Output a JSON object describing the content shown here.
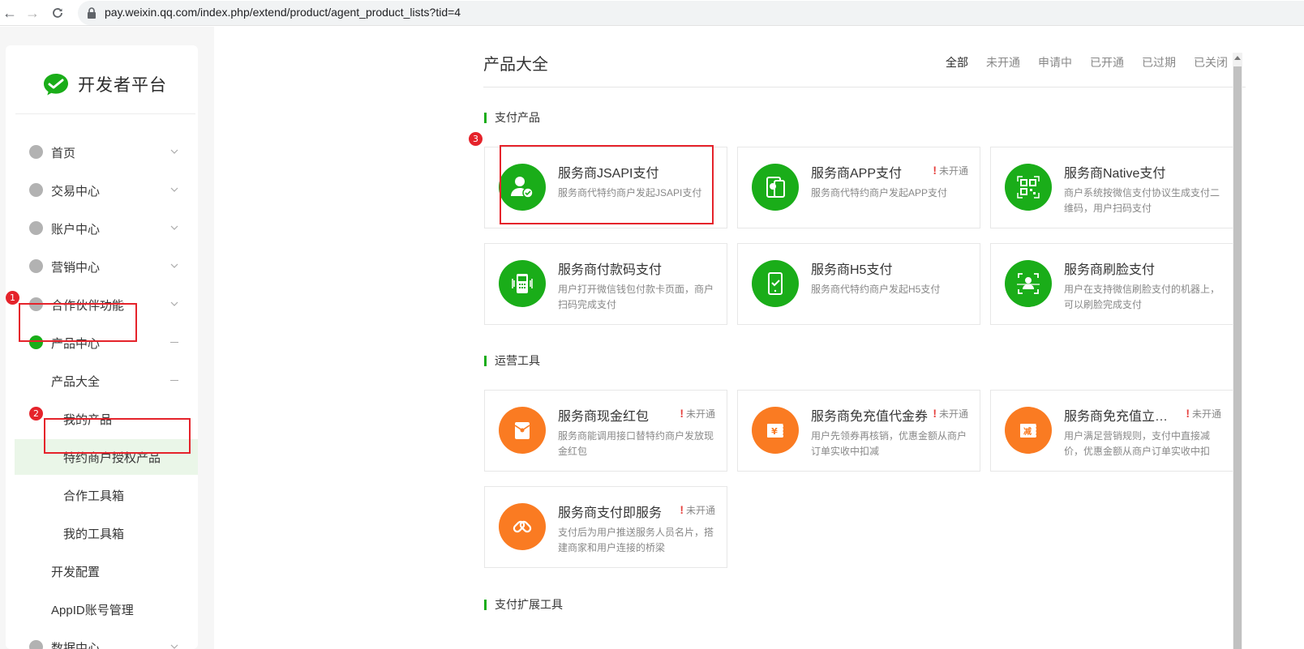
{
  "browser": {
    "url": "pay.weixin.qq.com/index.php/extend/product/agent_product_lists?tid=4"
  },
  "sidebar": {
    "logo_text": "开发者平台",
    "items": [
      {
        "label": "首页"
      },
      {
        "label": "交易中心"
      },
      {
        "label": "账户中心"
      },
      {
        "label": "营销中心"
      },
      {
        "label": "合作伙伴功能"
      },
      {
        "label": "产品中心"
      },
      {
        "label": "产品大全"
      },
      {
        "label": "我的产品"
      },
      {
        "label": "特约商户授权产品"
      },
      {
        "label": "合作工具箱"
      },
      {
        "label": "我的工具箱"
      },
      {
        "label": "开发配置"
      },
      {
        "label": "AppID账号管理"
      },
      {
        "label": "数据中心"
      }
    ]
  },
  "annotations": {
    "one": "1",
    "two": "2",
    "three": "3"
  },
  "main": {
    "title": "产品大全",
    "filters": [
      "全部",
      "未开通",
      "申请中",
      "已开通",
      "已过期",
      "已关闭"
    ],
    "sections": [
      "支付产品",
      "运营工具",
      "支付扩展工具"
    ],
    "cards": [
      {
        "title": "服务商JSAPI支付",
        "status": "",
        "desc": "服务商代特约商户发起JSAPI支付",
        "color": "#1aad19",
        "icon": "user-check-icon"
      },
      {
        "title": "服务商APP支付",
        "status": "未开通",
        "desc": "服务商代特约商户发起APP支付",
        "color": "#1aad19",
        "icon": "mobile-app-icon"
      },
      {
        "title": "服务商Native支付",
        "status": "",
        "desc": "商户系统按微信支付协议生成支付二维码，用户扫码支付",
        "color": "#1aad19",
        "icon": "qrcode-icon"
      },
      {
        "title": "服务商付款码支付",
        "status": "",
        "desc": "用户打开微信钱包付款卡页面，商户扫码完成支付",
        "color": "#1aad19",
        "icon": "scanner-icon"
      },
      {
        "title": "服务商H5支付",
        "status": "",
        "desc": "服务商代特约商户发起H5支付",
        "color": "#1aad19",
        "icon": "phone-check-icon"
      },
      {
        "title": "服务商刷脸支付",
        "status": "",
        "desc": "用户在支持微信刷脸支付的机器上，可以刷脸完成支付",
        "color": "#1aad19",
        "icon": "face-scan-icon"
      },
      {
        "title": "服务商现金红包",
        "status": "未开通",
        "desc": "服务商能调用接口替特约商户发放现金红包",
        "color": "#fa7b22",
        "icon": "red-envelope-icon"
      },
      {
        "title": "服务商免充值代金券",
        "status": "未开通",
        "desc": "用户先领券再核销，优惠金额从商户订单实收中扣减",
        "color": "#fa7b22",
        "icon": "coupon-yuan-icon"
      },
      {
        "title": "服务商免充值立减与折扣",
        "status": "未开通",
        "desc": "用户满足营销规则，支付中直接减价，优惠金额从商户订单实收中扣",
        "color": "#fa7b22",
        "icon": "discount-icon"
      },
      {
        "title": "服务商支付即服务",
        "status": "未开通",
        "desc": "支付后为用户推送服务人员名片，搭建商家和用户连接的桥梁",
        "color": "#fa7b22",
        "icon": "link-icon"
      }
    ]
  },
  "colors": {
    "brand_green": "#1aad19",
    "orange": "#fa7b22",
    "highlight_red": "#e5232b"
  }
}
